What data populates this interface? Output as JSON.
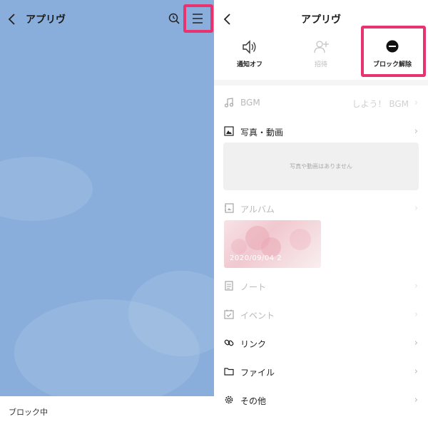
{
  "left": {
    "title": "アプリヴ",
    "footer_status": "ブロック中",
    "highlight_color": "#e8336f"
  },
  "right": {
    "title": "アプリヴ",
    "actions": [
      {
        "label": "通知オフ",
        "icon": "speaker-icon"
      },
      {
        "label": "招待",
        "icon": "add-person-icon"
      },
      {
        "label": "ブロック解除",
        "icon": "minus-circle-icon"
      }
    ],
    "rows": {
      "bgm": {
        "label": "BGM",
        "value": "しよう！ BGM",
        "icon": "music-note-icon"
      },
      "photos": {
        "label": "写真・動画",
        "empty": "写真や動画はありません",
        "icon": "photo-icon"
      },
      "album": {
        "label": "アルバム",
        "thumb_caption": "2020/09/04 2",
        "icon": "album-icon"
      },
      "note": {
        "label": "ノート",
        "icon": "note-icon"
      },
      "event": {
        "label": "イベント",
        "icon": "calendar-check-icon"
      },
      "link": {
        "label": "リンク",
        "icon": "link-icon"
      },
      "file": {
        "label": "ファイル",
        "icon": "folder-icon"
      },
      "other": {
        "label": "その他",
        "icon": "gear-icon"
      }
    }
  }
}
